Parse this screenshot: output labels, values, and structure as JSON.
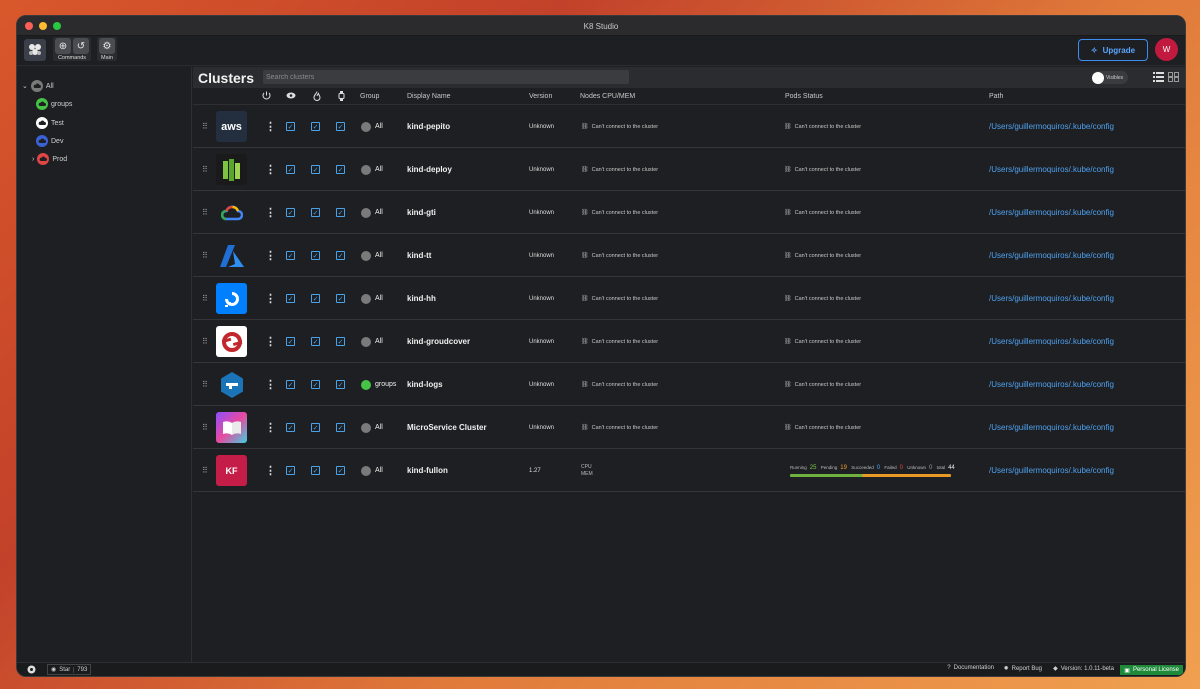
{
  "window": {
    "title": "K8 Studio"
  },
  "toolbar": {
    "commands_label": "Commands",
    "main_label": "Main",
    "upgrade_label": "Upgrade",
    "avatar_initial": "W"
  },
  "sidebar": {
    "items": [
      {
        "label": "All",
        "color": "#7a7a7a"
      },
      {
        "label": "groups",
        "color": "#46c246"
      },
      {
        "label": "Test",
        "color": "#ffffff"
      },
      {
        "label": "Dev",
        "color": "#3a62d6"
      },
      {
        "label": "Prod",
        "color": "#e04646"
      }
    ]
  },
  "main": {
    "title": "Clusters",
    "search_placeholder": "Search clusters",
    "toggle_label": "Visibles",
    "columns": {
      "group": "Group",
      "display_name": "Display Name",
      "version": "Version",
      "nodes": "Nodes CPU/MEM",
      "pods": "Pods Status",
      "path": "Path"
    },
    "rows": [
      {
        "logo": "aws",
        "logo_text": "aws",
        "group": "All",
        "name": "kind-pepito",
        "version": "Unknown",
        "nodes": "Can't connect to the cluster",
        "pods": "Can't connect to the cluster",
        "path": "/Users/guillermoquiros/.kube/config"
      },
      {
        "logo": "bars",
        "logo_text": "",
        "group": "All",
        "name": "kind-deploy",
        "version": "Unknown",
        "nodes": "Can't connect to the cluster",
        "pods": "Can't connect to the cluster",
        "path": "/Users/guillermoquiros/.kube/config"
      },
      {
        "logo": "gcp",
        "logo_text": "",
        "group": "All",
        "name": "kind-gti",
        "version": "Unknown",
        "nodes": "Can't connect to the cluster",
        "pods": "Can't connect to the cluster",
        "path": "/Users/guillermoquiros/.kube/config"
      },
      {
        "logo": "azure",
        "logo_text": "",
        "group": "All",
        "name": "kind-tt",
        "version": "Unknown",
        "nodes": "Can't connect to the cluster",
        "pods": "Can't connect to the cluster",
        "path": "/Users/guillermoquiros/.kube/config"
      },
      {
        "logo": "digitalocean",
        "logo_text": "",
        "group": "All",
        "name": "kind-hh",
        "version": "Unknown",
        "nodes": "Can't connect to the cluster",
        "pods": "Can't connect to the cluster",
        "path": "/Users/guillermoquiros/.kube/config"
      },
      {
        "logo": "openshift",
        "logo_text": "",
        "group": "All",
        "name": "kind-groudcover",
        "version": "Unknown",
        "nodes": "Can't connect to the cluster",
        "pods": "Can't connect to the cluster",
        "path": "/Users/guillermoquiros/.kube/config"
      },
      {
        "logo": "hexagon",
        "logo_text": "",
        "group": "groups",
        "group_color": "#46c246",
        "name": "kind-logs",
        "version": "Unknown",
        "nodes": "Can't connect to the cluster",
        "pods": "Can't connect to the cluster",
        "path": "/Users/guillermoquiros/.kube/config"
      },
      {
        "logo": "book",
        "logo_text": "",
        "group": "All",
        "name": "MicroService Cluster",
        "version": "Unknown",
        "nodes": "Can't connect to the cluster",
        "pods": "Can't connect to the cluster",
        "path": "/Users/guillermoquiros/.kube/config"
      },
      {
        "logo": "kf",
        "logo_text": "KF",
        "group": "All",
        "name": "kind-fullon",
        "version": "1.27",
        "cpu_label": "CPU",
        "mem_label": "MEM",
        "path": "/Users/guillermoquiros/.kube/config",
        "pods_stats": {
          "running_label": "Running",
          "running": "25",
          "pending_label": "Pending",
          "pending": "19",
          "succeeded_label": "Succeeded",
          "succeeded": "0",
          "failed_label": "Failed",
          "failed": "0",
          "unknown_label": "Unknown",
          "unknown": "0",
          "total_label": "total",
          "total": "44"
        }
      }
    ]
  },
  "statusbar": {
    "star_label": "Star",
    "star_count": "793",
    "documentation": "Documentation",
    "report_bug": "Report Bug",
    "version": "Version: 1.0.11-beta",
    "license": "Personal License"
  }
}
